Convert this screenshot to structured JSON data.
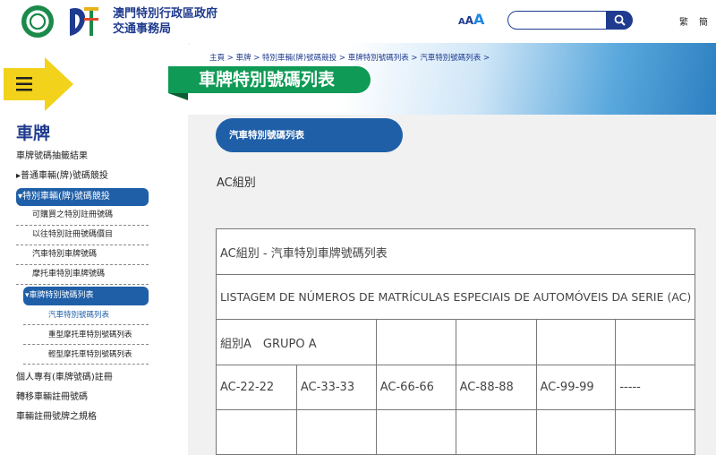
{
  "header": {
    "org_name_line1": "澳門特別行政區政府",
    "org_name_line2": "交通事務局",
    "font_small": "A",
    "font_medium": "A",
    "font_large": "A",
    "search_placeholder": "",
    "lang_1": "繁",
    "lang_2": "簡"
  },
  "sidebar": {
    "title": "車牌",
    "items": [
      {
        "label": "車牌號碼抽籤結果"
      },
      {
        "label": "▸普通車輛(牌)號碼競投"
      },
      {
        "label": "▾特別車輛(牌)號碼競投"
      }
    ],
    "sub_items": [
      {
        "label": "可購買之特別註冊號碼"
      },
      {
        "label": "以往特別註冊號碼價目"
      },
      {
        "label": "汽車特別車牌號碼"
      },
      {
        "label": "摩托車特別車牌號碼"
      },
      {
        "label": "▾車牌特別號碼列表"
      }
    ],
    "sub2_items": [
      {
        "label": "汽車特別號碼列表"
      },
      {
        "label": "重型摩托車特別號碼列表"
      },
      {
        "label": "輕型摩托車特別號碼列表"
      }
    ],
    "bottom_items": [
      {
        "label": "個人專有(車牌號碼)註冊"
      },
      {
        "label": "轉移車輛註冊號碼"
      },
      {
        "label": "車輛註冊號牌之規格"
      }
    ]
  },
  "breadcrumb": "主頁 > 車牌 > 特別車輛(牌)號碼競投 > 車牌特別號碼列表 > 汽車特別號碼列表 >",
  "page_title": "車牌特別號碼列表",
  "sub_pill": "汽車特別號碼列表",
  "group_label": "AC組別",
  "table": {
    "title_zh": "AC組別 - 汽車特別車牌號碼列表",
    "title_pt": "LISTAGEM DE NÚMEROS DE MATRÍCULAS ESPECIAIS DE AUTOMÓVEIS DA SERIE (AC)",
    "group_cell": "組別A　GRUPO A",
    "row1": [
      "AC-22-22",
      "AC-33-33",
      "AC-66-66",
      "AC-88-88",
      "AC-99-99",
      "-----"
    ]
  },
  "colors": {
    "navy": "#1f3b8f",
    "active_blue": "#1f5fa8",
    "title_green": "#0f9a55",
    "menu_yellow": "#f2d21a"
  }
}
